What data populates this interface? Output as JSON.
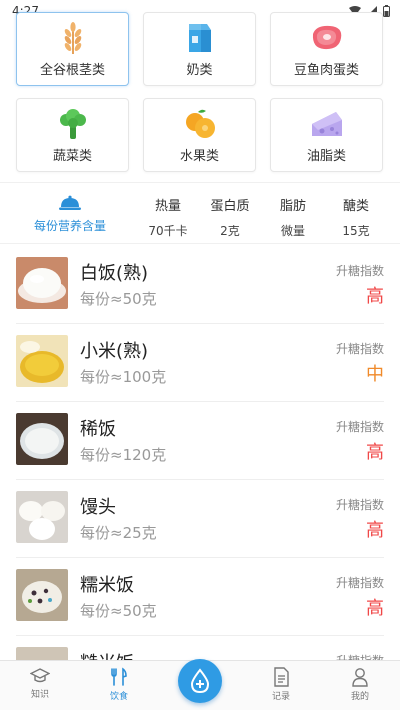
{
  "status_bar": {
    "time": "4:27"
  },
  "categories": [
    {
      "label": "全谷根茎类",
      "icon": "wheat-icon",
      "active": true
    },
    {
      "label": "奶类",
      "icon": "milk-carton-icon",
      "active": false
    },
    {
      "label": "豆鱼肉蛋类",
      "icon": "meat-icon",
      "active": false
    },
    {
      "label": "蔬菜类",
      "icon": "broccoli-icon",
      "active": false
    },
    {
      "label": "水果类",
      "icon": "orange-icon",
      "active": false
    },
    {
      "label": "油脂类",
      "icon": "cheese-icon",
      "active": false
    }
  ],
  "nutrition": {
    "title": "每份营养含量",
    "columns": [
      {
        "name": "热量",
        "value": "70千卡"
      },
      {
        "name": "蛋白质",
        "value": "2克"
      },
      {
        "name": "脂肪",
        "value": "微量"
      },
      {
        "name": "醣类",
        "value": "15克"
      }
    ]
  },
  "foods": [
    {
      "name": "白饭(熟)",
      "portion": "每份≈50克",
      "gi_label": "升糖指数",
      "gi": "高",
      "gi_color": "#f04848"
    },
    {
      "name": "小米(熟)",
      "portion": "每份≈100克",
      "gi_label": "升糖指数",
      "gi": "中",
      "gi_color": "#f08a2a"
    },
    {
      "name": "稀饭",
      "portion": "每份≈120克",
      "gi_label": "升糖指数",
      "gi": "高",
      "gi_color": "#f04848"
    },
    {
      "name": "馒头",
      "portion": "每份≈25克",
      "gi_label": "升糖指数",
      "gi": "高",
      "gi_color": "#f04848"
    },
    {
      "name": "糯米饭",
      "portion": "每份≈50克",
      "gi_label": "升糖指数",
      "gi": "高",
      "gi_color": "#f04848"
    },
    {
      "name": "糙米饭",
      "portion": "",
      "gi_label": "升糖指数",
      "gi": "",
      "gi_color": "#f04848"
    }
  ],
  "bottom_nav": {
    "items": [
      {
        "label": "知识",
        "icon": "graduation-cap-icon"
      },
      {
        "label": "饮食",
        "icon": "fork-knife-icon"
      },
      {
        "label": "记录",
        "icon": "document-icon"
      },
      {
        "label": "我的",
        "icon": "person-icon"
      }
    ],
    "center_icon": "droplet-plus-icon"
  },
  "colors": {
    "accent": "#2f9be4",
    "gi_high": "#f04848",
    "gi_medium": "#f08a2a"
  }
}
